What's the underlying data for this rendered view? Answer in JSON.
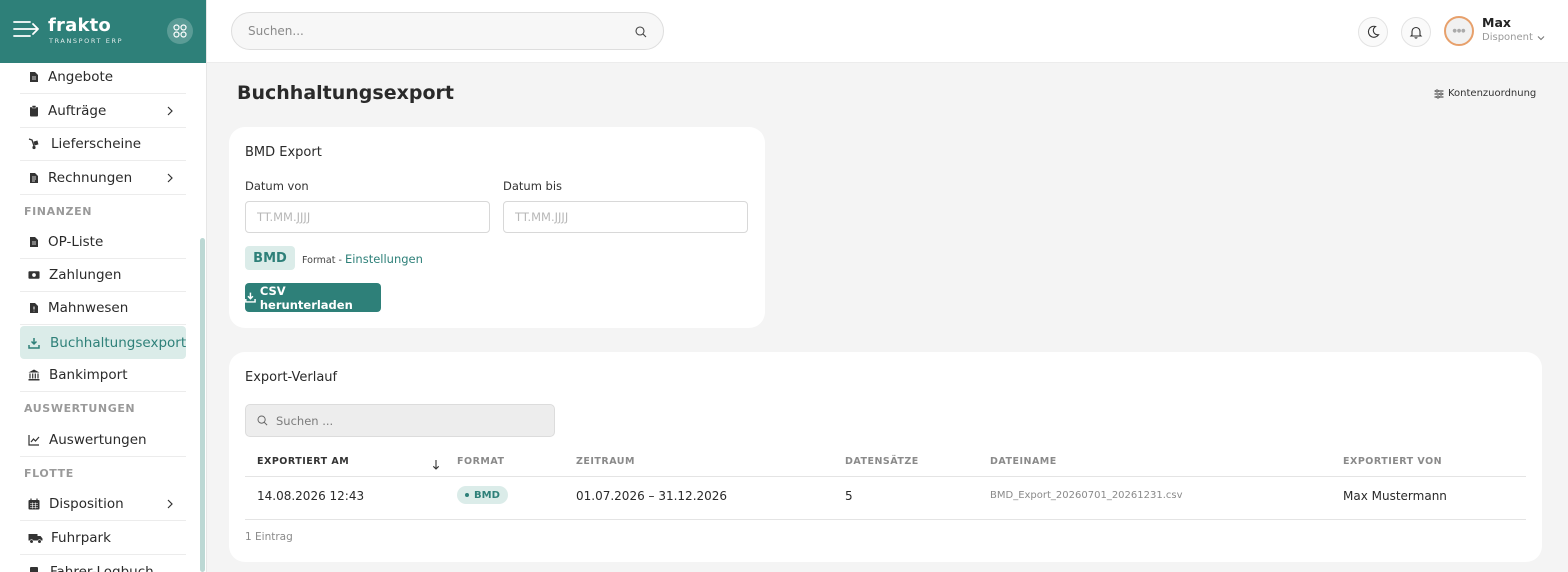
{
  "brand": {
    "name": "frakto",
    "subtitle": "TRANSPORT ERP"
  },
  "sidebar": {
    "items": [
      {
        "label": "Angebote",
        "icon": "document-icon",
        "expandable": false
      },
      {
        "label": "Aufträge",
        "icon": "clipboard-icon",
        "expandable": true
      },
      {
        "label": "Lieferscheine",
        "icon": "dolly-icon",
        "expandable": false
      },
      {
        "label": "Rechnungen",
        "icon": "invoice-icon",
        "expandable": true
      },
      {
        "label": "OP-Liste",
        "icon": "document-icon",
        "expandable": false
      },
      {
        "label": "Zahlungen",
        "icon": "cash-icon",
        "expandable": false
      },
      {
        "label": "Mahnwesen",
        "icon": "document-alert-icon",
        "expandable": false
      },
      {
        "label": "Buchhaltungsexport",
        "icon": "download-icon",
        "expandable": false,
        "active": true
      },
      {
        "label": "Bankimport",
        "icon": "bank-icon",
        "expandable": false
      },
      {
        "label": "Auswertungen",
        "icon": "chart-line-icon",
        "expandable": false
      },
      {
        "label": "Disposition",
        "icon": "calendar-icon",
        "expandable": true
      },
      {
        "label": "Fuhrpark",
        "icon": "truck-icon",
        "expandable": false
      },
      {
        "label": "Fahrer-Logbuch",
        "icon": "book-icon",
        "expandable": false
      }
    ],
    "sections": {
      "finanzen": "FINANZEN",
      "auswertungen": "AUSWERTUNGEN",
      "flotte": "FLOTTE"
    }
  },
  "header": {
    "search_placeholder": "Suchen...",
    "user": {
      "name": "Max",
      "role": "Disponent"
    }
  },
  "page": {
    "title": "Buchhaltungsexport",
    "mapping_link": "Kontenzuordnung"
  },
  "export_card": {
    "title": "BMD Export",
    "date_from_label": "Datum von",
    "date_to_label": "Datum bis",
    "date_placeholder": "TT.MM.JJJJ",
    "format_chip": "BMD",
    "format_text": "Format - ",
    "settings_link": "Einstellungen",
    "download_button": "CSV herunterladen"
  },
  "history": {
    "title": "Export-Verlauf",
    "search_placeholder": "Suchen ...",
    "columns": [
      "EXPORTIERT AM",
      "FORMAT",
      "ZEITRAUM",
      "DATENSÄTZE",
      "DATEINAME",
      "EXPORTIERT VON"
    ],
    "rows": [
      {
        "exported_at": "14.08.2026 12:43",
        "format": "BMD",
        "period": "01.07.2026 – 31.12.2026",
        "records": "5",
        "filename": "BMD_Export_20260701_20261231.csv",
        "exported_by": "Max Mustermann"
      }
    ],
    "footer": "1 Eintrag"
  },
  "colors": {
    "accent": "#2e8079",
    "accent_light": "#dbece9"
  }
}
